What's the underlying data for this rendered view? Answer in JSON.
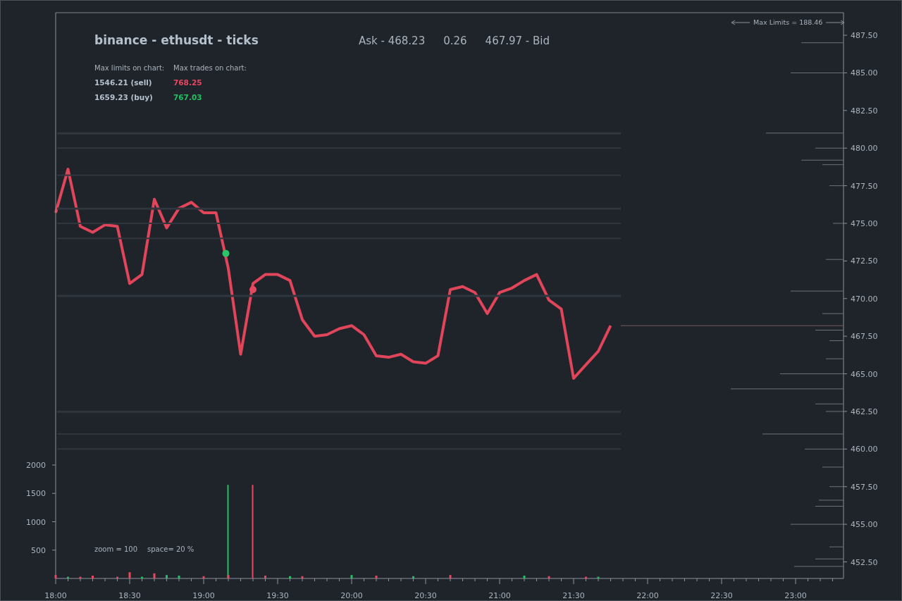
{
  "header": {
    "title": "binance - ethusdt - ticks",
    "ask": "Ask - 468.23",
    "spread": "0.26",
    "bid": "467.97 - Bid"
  },
  "stats": {
    "limits_label": "Max limits on chart:",
    "trades_label": "Max trades on chart:",
    "rows": [
      {
        "limit": "1546.21 (sell)",
        "trade": "768.25",
        "color": "#e8485f"
      },
      {
        "limit": "1659.23 (buy)",
        "trade": "767.03",
        "color": "#22c063"
      }
    ]
  },
  "order_book": {
    "label": "Max Limits = 188.46"
  },
  "footer_note": {
    "zoom": "zoom = 100",
    "space": "space= 20 %"
  },
  "price_chart": {
    "chart_data": {
      "type": "line",
      "categories": [
        "18:00",
        null,
        null,
        null,
        null,
        null,
        "18:30",
        null,
        null,
        null,
        null,
        null,
        "19:00",
        null,
        null,
        null,
        null,
        null,
        "19:30",
        null,
        null,
        null,
        null,
        null,
        "20:00",
        null,
        null,
        null,
        null,
        null,
        "20:30",
        null,
        null,
        null,
        null,
        null,
        "21:00",
        null,
        null,
        null,
        null,
        null,
        "21:30",
        null,
        null,
        null,
        null,
        null,
        "22:00",
        null,
        null,
        null,
        null,
        null,
        "22:30",
        null,
        null,
        null,
        null,
        null,
        "23:00",
        null,
        null,
        null
      ],
      "series": [
        {
          "color": "#e0455a",
          "values": [
            475.7,
            478.6,
            474.8,
            474.4,
            474.9,
            474.8,
            471.0,
            471.6,
            476.6,
            474.7,
            476.0,
            476.4,
            475.7,
            475.7,
            472.0,
            466.3,
            471.0,
            471.6,
            471.6,
            471.2,
            468.6,
            467.5,
            467.6,
            468.0,
            468.2,
            467.6,
            466.2,
            466.1,
            466.3,
            465.8,
            465.7,
            466.2,
            470.6,
            470.8,
            470.4,
            469.0,
            470.4,
            470.7,
            471.2,
            471.6,
            469.9,
            469.3,
            464.7,
            465.6,
            466.5,
            468.2,
            null,
            null,
            null,
            null,
            null,
            null,
            null,
            null,
            null,
            null,
            null,
            null,
            null,
            null,
            null,
            null,
            null,
            null
          ]
        }
      ],
      "ylim": [
        451.4,
        489
      ],
      "yticks": [
        {
          "value": 452.5,
          "label": "452.50"
        },
        {
          "value": 455,
          "label": "455.00"
        },
        {
          "value": 457.5,
          "label": "457.50"
        },
        {
          "value": 460,
          "label": "460.00"
        },
        {
          "value": 462.5,
          "label": "462.50"
        },
        {
          "value": 465,
          "label": "465.00"
        },
        {
          "value": 467.5,
          "label": "467.50"
        },
        {
          "value": 470,
          "label": "470.00"
        },
        {
          "value": 472.5,
          "label": "472.50"
        },
        {
          "value": 475,
          "label": "475.00"
        },
        {
          "value": 477.5,
          "label": "477.50"
        },
        {
          "value": 480,
          "label": "480.00"
        },
        {
          "value": 482.5,
          "label": "482.50"
        },
        {
          "value": 485,
          "label": "485.00"
        },
        {
          "value": 487.5,
          "label": "487.50"
        }
      ]
    },
    "markers": [
      {
        "color": "#2bc46a"
      },
      {
        "color": "#e8485f"
      }
    ]
  },
  "volume_chart": {
    "chart_data": {
      "type": "bar",
      "series": [
        {
          "color": "#22c063",
          "values": [
            null,
            30,
            null,
            null,
            null,
            null,
            null,
            30,
            null,
            60,
            50,
            null,
            null,
            null,
            1650,
            null,
            null,
            null,
            null,
            40,
            null,
            null,
            null,
            null,
            60,
            null,
            null,
            null,
            null,
            40,
            null,
            null,
            null,
            null,
            null,
            null,
            null,
            null,
            50,
            null,
            null,
            null,
            null,
            null,
            30,
            null,
            null,
            null,
            null,
            null,
            null,
            null,
            null,
            null,
            null,
            null,
            null,
            null,
            null,
            null,
            null,
            null,
            null,
            null
          ]
        },
        {
          "color": "#e8485f",
          "values": [
            60,
            null,
            30,
            50,
            null,
            30,
            110,
            null,
            90,
            null,
            null,
            null,
            40,
            null,
            60,
            null,
            1650,
            50,
            null,
            null,
            40,
            null,
            null,
            null,
            null,
            null,
            50,
            null,
            null,
            null,
            null,
            null,
            60,
            null,
            null,
            null,
            null,
            null,
            null,
            null,
            40,
            null,
            null,
            30,
            null,
            null,
            null,
            null,
            null,
            null,
            null,
            null,
            null,
            null,
            null,
            null,
            null,
            null,
            null,
            null,
            null,
            null,
            null,
            null
          ]
        }
      ],
      "ylim": [
        0,
        2000
      ],
      "yticks": [
        500,
        1000,
        1500,
        2000
      ]
    }
  }
}
